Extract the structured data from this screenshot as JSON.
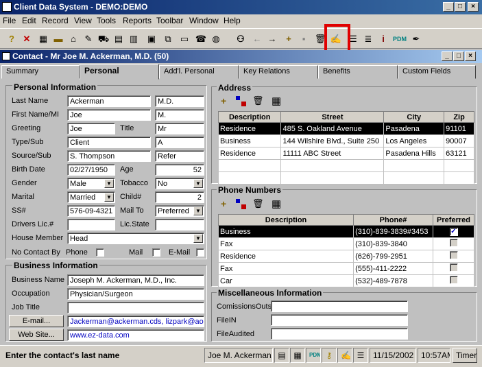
{
  "app": {
    "title": "Client Data System - DEMO:DEMO"
  },
  "menu": [
    "File",
    "Edit",
    "Record",
    "View",
    "Tools",
    "Reports",
    "Toolbar",
    "Window",
    "Help"
  ],
  "toolbar_icons": [
    "help-icon",
    "delete-icon",
    "calculator-icon",
    "ruler-icon",
    "home-icon",
    "edit-pencil-icon",
    "car-icon",
    "grid-icon",
    "grid2-icon",
    "calc2-icon",
    "copy-icon",
    "money-icon",
    "phone-icon",
    "globe-icon",
    "binoculars-icon",
    "back-arrow-icon",
    "forward-arrow-icon",
    "plus-icon",
    "save-icon",
    "trash-icon",
    "notes-icon",
    "list-icon",
    "list2-icon",
    "info-icon",
    "pdm-icon",
    "signature-icon"
  ],
  "child": {
    "title": "Contact - Mr Joe M. Ackerman, M.D. (50)"
  },
  "tabs": [
    "Summary",
    "Personal",
    "Add'l. Personal",
    "Key Relations",
    "Benefits",
    "Custom Fields"
  ],
  "personal": {
    "header": "Personal Information",
    "last_name_label": "Last Name",
    "last_name": "Ackerman",
    "suffix": "M.D.",
    "first_name_label": "First Name/MI",
    "first_name": "Joe",
    "mi": "M.",
    "greeting_label": "Greeting",
    "greeting": "Joe",
    "title_label": "Title",
    "title": "Mr",
    "type_label": "Type/Sub",
    "type": "Client",
    "sub": "A",
    "source_label": "Source/Sub",
    "source": "S. Thompson",
    "source_sub": "Refer",
    "birth_label": "Birth Date",
    "birth": "02/27/1950",
    "age_label": "Age",
    "age": "52",
    "gender_label": "Gender",
    "gender": "Male",
    "tobacco_label": "Tobacco",
    "tobacco": "No",
    "marital_label": "Marital",
    "marital": "Married",
    "child_label": "Child#",
    "child": "2",
    "ss_label": "SS#",
    "ss": "576-09-4321",
    "mailto_label": "Mail To",
    "mailto": "Preferred",
    "drivers_label": "Drivers Lic.#",
    "drivers": "",
    "licstate_label": "Lic.State",
    "licstate": "",
    "house_label": "House Member",
    "house": "Head",
    "nocontact_label": "No Contact By",
    "phone_label": "Phone",
    "mail_label": "Mail",
    "email_label": "E-Mail"
  },
  "business": {
    "header": "Business Information",
    "name_label": "Business Name",
    "name": "Joseph M. Ackerman, M.D., Inc.",
    "occupation_label": "Occupation",
    "occupation": "Physician/Surgeon",
    "jobtitle_label": "Job Title",
    "jobtitle": "",
    "email_button": "E-mail...",
    "email": "Jackerman@ackerman.cds, lizpark@aol.",
    "web_button": "Web Site...",
    "web": "www.ez-data.com"
  },
  "address": {
    "header": "Address",
    "columns": [
      "Description",
      "Street",
      "City",
      "Zip"
    ],
    "rows": [
      [
        "Residence",
        "485 S. Oakland Avenue",
        "Pasadena",
        "91101"
      ],
      [
        "Business",
        "144 Wilshire Blvd., Suite 250",
        "Los Angeles",
        "90007"
      ],
      [
        "Residence",
        "11111  ABC Street",
        "Pasadena Hills",
        "63121"
      ]
    ]
  },
  "phones": {
    "header": "Phone Numbers",
    "columns": [
      "Description",
      "Phone#",
      "Preferred"
    ],
    "rows": [
      [
        "Business",
        "(310)-839-3839#3453"
      ],
      [
        "Fax",
        "(310)-839-3840"
      ],
      [
        "Residence",
        "(626)-799-2951"
      ],
      [
        "Fax",
        "(555)-411-2222"
      ],
      [
        "Car",
        "(532)-489-7878"
      ]
    ]
  },
  "misc": {
    "header": "Miscellaneous Information",
    "commissions_label": "ComissionsOuts",
    "filein_label": "FileIN",
    "fileaudited_label": "FileAudited"
  },
  "status": {
    "message": "Enter the contact's last name",
    "contact": "Joe M. Ackerman, M",
    "date": "11/15/2002",
    "time": "10:57AM",
    "timer": "Timer"
  }
}
